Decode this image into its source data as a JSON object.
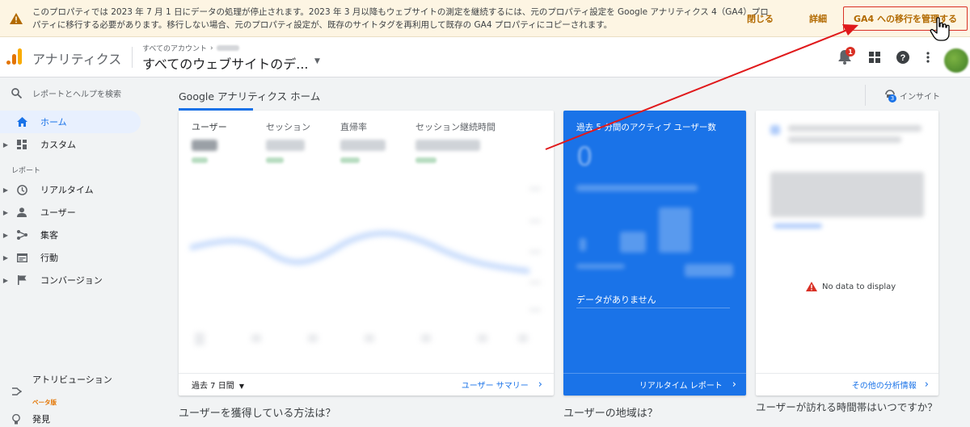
{
  "banner": {
    "message": "このプロパティでは 2023 年 7 月 1 日にデータの処理が停止されます。2023 年 3 月以降もウェブサイトの測定を継続するには、元のプロパティ設定を Google アナリティクス 4（GA4）プロパティに移行する必要があります。移行しない場合、元のプロパティ設定が、既存のサイトタグを再利用して既存の GA4 プロパティにコピーされます。",
    "close_label": "閉じる",
    "details_label": "詳細",
    "migrate_label": "GA4 への移行を管理する"
  },
  "header": {
    "app_name": "アナリティクス",
    "crumb": "すべてのアカウント",
    "property": "すべてのウェブサイトのデ...",
    "notification_count": "1"
  },
  "sidebar": {
    "search_label": "レポートとヘルプを検索",
    "home": "ホーム",
    "custom": "カスタム",
    "reports_section": "レポート",
    "realtime": "リアルタイム",
    "users": "ユーザー",
    "acquisition": "集客",
    "behavior": "行動",
    "conversions": "コンバージョン",
    "attribution": "アトリビューション",
    "beta": "ベータ版",
    "discover": "発見"
  },
  "main": {
    "title": "Google アナリティクス ホーム",
    "insight_label": "インサイト",
    "insight_count": "3",
    "metrics": [
      "ユーザー",
      "セッション",
      "直帰率",
      "セッション継続時間"
    ],
    "range_label": "過去 7 日間",
    "users_summary_link": "ユーザー サマリー",
    "bottom_heading_1": "ユーザーを獲得している方法は？",
    "bottom_heading_2": "ユーザーの地域は？",
    "bottom_heading_3": "ユーザーが訪れる時間帯はいつですか？"
  },
  "realtime": {
    "title": "過去 5 分間のアクティブ ユーザー数",
    "value": "0",
    "no_data": "データがありません",
    "link": "リアルタイム レポート"
  },
  "analytics": {
    "no_data": "No data to display",
    "link": "その他の分析情報"
  },
  "colors": {
    "accent": "#1a73e8",
    "banner_bg": "#fdf5e3",
    "warning": "#d93025",
    "annotation_arrow": "#e0191b"
  }
}
